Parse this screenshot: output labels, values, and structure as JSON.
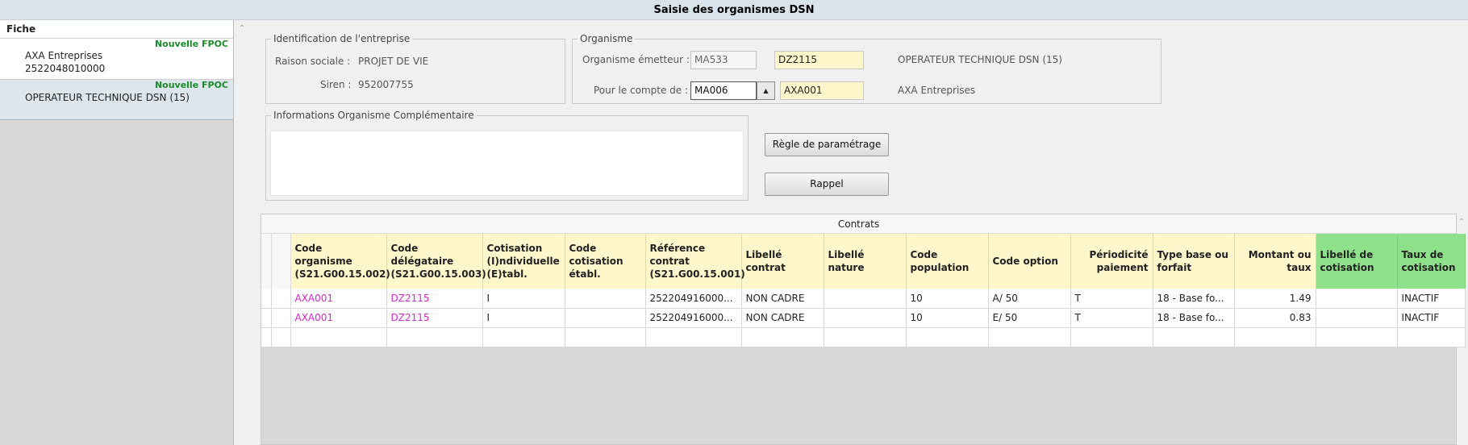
{
  "window": {
    "title": "Saisie des organismes DSN"
  },
  "sidebar": {
    "header": "Fiche",
    "cards": [
      {
        "badge": "Nouvelle FPOC",
        "line1": "AXA Entreprises",
        "line2": "2522048010000"
      },
      {
        "badge": "Nouvelle FPOC",
        "line1": "OPERATEUR TECHNIQUE DSN (15)",
        "line2": ""
      }
    ]
  },
  "identification": {
    "legend": "Identification de l'entreprise",
    "raison_label": "Raison sociale :",
    "raison_value": "PROJET DE VIE",
    "siren_label": "Siren :",
    "siren_value": "952007755"
  },
  "organisme": {
    "legend": "Organisme",
    "emetteur_label": "Organisme émetteur :",
    "emetteur_code": "MA533",
    "emetteur_code2": "DZ2115",
    "emetteur_name": "OPERATEUR TECHNIQUE DSN (15)",
    "compte_label": "Pour le compte de :",
    "compte_code": "MA006",
    "compte_code2": "AXA001",
    "compte_name": "AXA Entreprises"
  },
  "infos": {
    "legend": "Informations Organisme Complémentaire",
    "value": ""
  },
  "buttons": {
    "regle": "Règle de paramétrage",
    "rappel": "Rappel"
  },
  "contrats": {
    "title": "Contrats",
    "columns": [
      "Code organisme (S21.G00.15.002)",
      "Code délégataire (S21.G00.15.003)",
      "Cotisation (I)ndividuelle (E)tabl.",
      "Code cotisation établ.",
      "Référence contrat (S21.G00.15.001)",
      "Libellé contrat",
      "Libellé nature",
      "Code population",
      "Code option",
      "Périodicité paiement",
      "Type base ou forfait",
      "Montant ou taux",
      "Libellé de cotisation",
      "Taux de cotisation"
    ],
    "rows": [
      [
        "AXA001",
        "DZ2115",
        "I",
        "",
        "252204916000...",
        "NON CADRE",
        "",
        "10",
        "A/ 50",
        "T",
        "18 - Base fo...",
        "1.49",
        "",
        "INACTIF"
      ],
      [
        "AXA001",
        "DZ2115",
        "I",
        "",
        "252204916000...",
        "NON CADRE",
        "",
        "10",
        "E/ 50",
        "T",
        "18 - Base fo...",
        "0.83",
        "",
        "INACTIF"
      ]
    ]
  },
  "colors": {
    "header_yellow": "#fff6cc",
    "header_green": "#8ee08a",
    "code_pink": "#d12bc8",
    "badge_green": "#1a8a2a"
  }
}
